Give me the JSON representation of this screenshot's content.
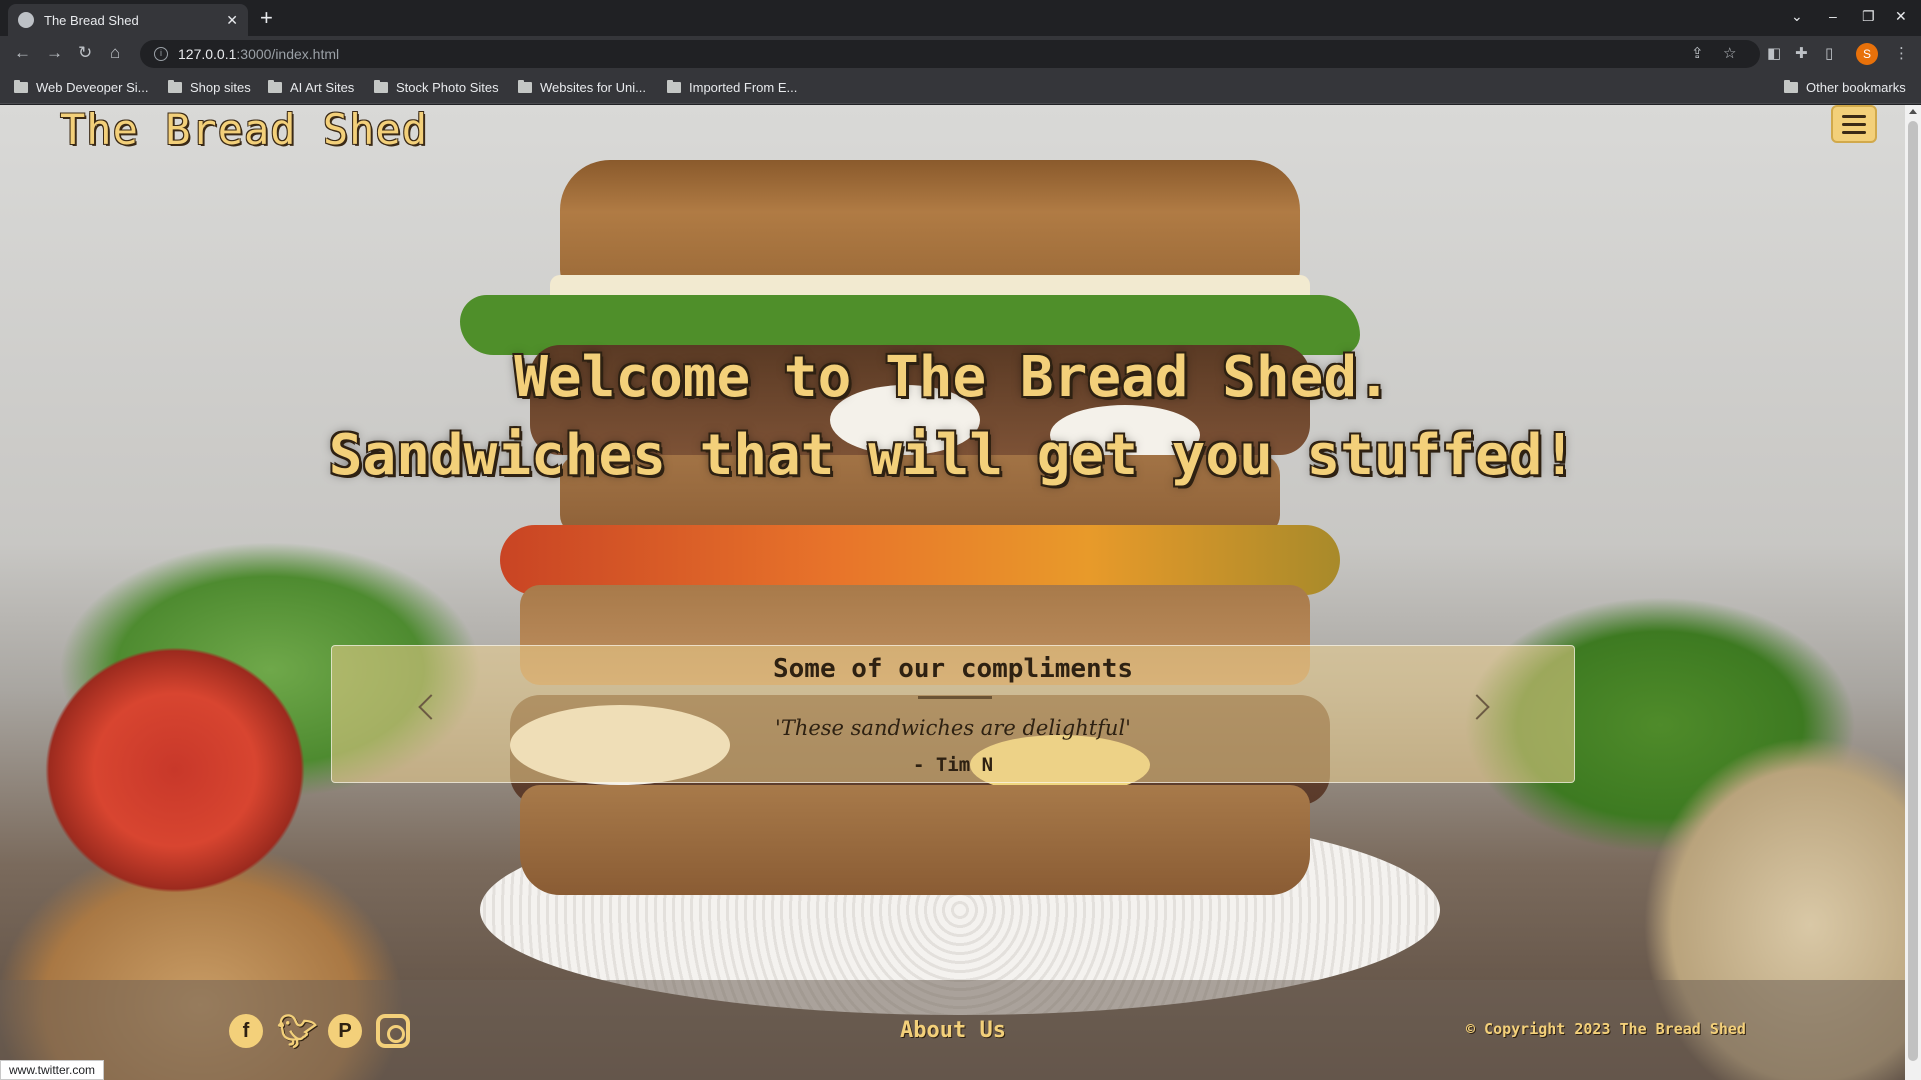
{
  "browser": {
    "tab_title": "The Bread Shed",
    "tab_close": "✕",
    "new_tab": "+",
    "url_host": "127.0.0.1",
    "url_rest": ":3000/index.html",
    "profile_initial": "S",
    "bookmarks": [
      "Web Deveoper Si...",
      "Shop sites",
      "AI Art Sites",
      "Stock Photo Sites",
      "Websites for Uni...",
      "Imported From E..."
    ],
    "other_bookmarks": "Other bookmarks",
    "status_url": "www.twitter.com"
  },
  "header": {
    "site_title": "The Bread Shed"
  },
  "hero": {
    "line1": "Welcome to The Bread Shed.",
    "line2": "Sandwiches that will get you stuffed!"
  },
  "testimonials": {
    "heading": "Some of our compliments",
    "quote": "'These sandwiches are delightful'",
    "author": "- Tim N"
  },
  "footer": {
    "social": [
      "facebook",
      "twitter",
      "pinterest",
      "instagram"
    ],
    "about_label": "About Us",
    "copyright": "© Copyright 2023 The Bread Shed"
  },
  "colors": {
    "accent": "#f3d07a",
    "text_dark": "#2e2112"
  }
}
